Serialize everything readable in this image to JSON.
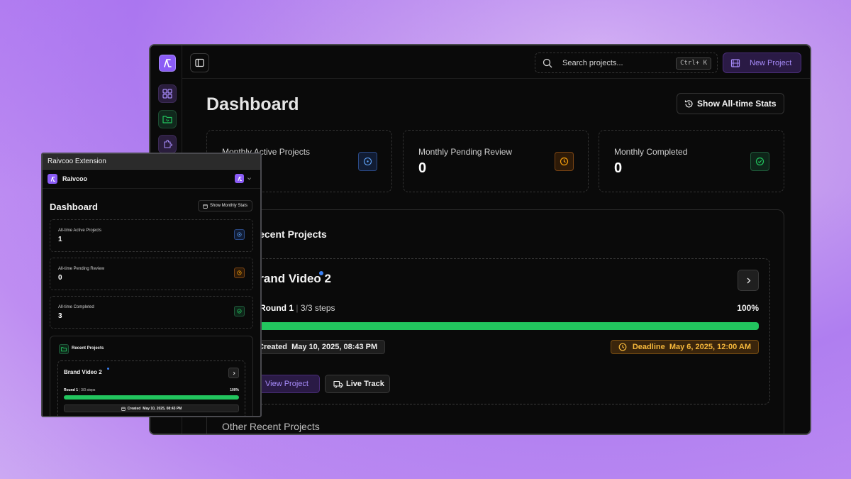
{
  "main": {
    "search": {
      "placeholder": "Search projects...",
      "shortcut": "Ctrl+ K"
    },
    "new_project_label": "New Project",
    "title": "Dashboard",
    "alltime_button": "Show All-time Stats",
    "stats": [
      {
        "label": "Monthly Active Projects",
        "value": ""
      },
      {
        "label": "Monthly Pending Review",
        "value": "0"
      },
      {
        "label": "Monthly Completed",
        "value": "0"
      }
    ],
    "recent_title": "Recent Projects",
    "project": {
      "name": "Brand Video 2",
      "round": "Round 1",
      "steps": "3/3 steps",
      "progress_pct": 100,
      "progress_label": "100%",
      "created_label": "Created",
      "created": "May 10, 2025, 08:43 PM",
      "deadline_label": "Deadline",
      "deadline": "May 6, 2025, 12:00 AM",
      "view_button": "View Project",
      "live_button": "Live Track"
    },
    "other_title": "Other Recent Projects"
  },
  "extension": {
    "window_title": "Raivcoo Extension",
    "brand": "Raivcoo",
    "title": "Dashboard",
    "monthly_button": "Show Monthly Stats",
    "stats": [
      {
        "label": "All-time Active Projects",
        "value": "1"
      },
      {
        "label": "All-time Pending Review",
        "value": "0"
      },
      {
        "label": "All-time Completed",
        "value": "3"
      }
    ],
    "recent_title": "Recent Projects",
    "project": {
      "name": "Brand Video 2",
      "round": "Round 1",
      "steps": "3/3 steps",
      "progress_pct": 100,
      "progress_label": "100%",
      "created_label": "Created",
      "created": "May 10, 2025, 08:43 PM"
    }
  },
  "colors": {
    "accent": "#8b5cf6",
    "progress": "#22c55e",
    "deadline": "#f5b73b",
    "info": "#3b82f6"
  },
  "icons": [
    "logo-icon",
    "grid-icon",
    "folder-icon",
    "puzzle-icon",
    "sidebar-toggle-icon",
    "search-icon",
    "film-icon",
    "history-icon",
    "circle-dot-icon",
    "clock-icon",
    "check-circle-icon",
    "chevron-right-icon",
    "truck-icon",
    "calendar-icon",
    "chevron-down-icon"
  ]
}
